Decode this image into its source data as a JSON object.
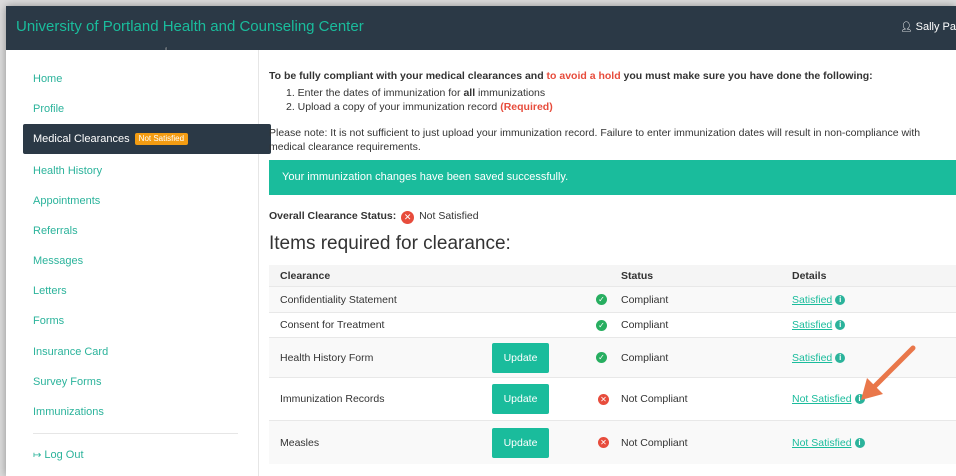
{
  "header": {
    "brand": "University of Portland Health and Counseling Center",
    "user": "Sally Pa"
  },
  "sidebar": {
    "items": [
      {
        "label": "Home"
      },
      {
        "label": "Profile"
      },
      {
        "label": "Medical Clearances",
        "badge": "Not Satisfied",
        "active": true
      },
      {
        "label": "Health History"
      },
      {
        "label": "Appointments"
      },
      {
        "label": "Referrals"
      },
      {
        "label": "Messages"
      },
      {
        "label": "Letters"
      },
      {
        "label": "Forms"
      },
      {
        "label": "Insurance Card"
      },
      {
        "label": "Survey Forms"
      },
      {
        "label": "Immunizations"
      }
    ],
    "logout": "Log Out"
  },
  "main": {
    "intro_a": "To be fully compliant with your medical clearances and ",
    "intro_red": "to avoid a hold",
    "intro_b": " you must make sure you have done the following:",
    "step1_a": "1. Enter the dates of immunization for ",
    "step1_bold": "all",
    "step1_b": " immunizations",
    "step2_a": "2. Upload a copy of your immunization record ",
    "step2_red": "(Required)",
    "note": "Please note: It is not sufficient to just upload your immunization record. Failure to enter immunization dates will result in non-compliance with medical clearance requirements.",
    "alert": "Your immunization changes have been saved successfully.",
    "overall_label": "Overall Clearance Status:",
    "overall_value": "Not Satisfied",
    "heading": "Items required for clearance:"
  },
  "table": {
    "headers": {
      "clearance": "Clearance",
      "status": "Status",
      "details": "Details"
    },
    "update_label": "Update",
    "rows": [
      {
        "name": "Confidentiality Statement",
        "status": "Compliant",
        "details": "Satisfied"
      },
      {
        "name": "Consent for Treatment",
        "status": "Compliant",
        "details": "Satisfied"
      },
      {
        "name": "Health History Form",
        "status": "Compliant",
        "details": "Satisfied"
      },
      {
        "name": "Immunization Records",
        "status": "Not Compliant",
        "details": "Not Satisfied"
      },
      {
        "name": "Measles",
        "status": "Not Compliant",
        "details": "Not Satisfied"
      }
    ]
  },
  "colors": {
    "accent": "#1abc9c",
    "navbar": "#2b3946",
    "badge": "#f39c12",
    "danger": "#e74c3c",
    "arrow": "#e9774a"
  }
}
